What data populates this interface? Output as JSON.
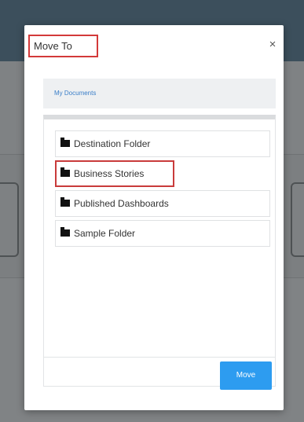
{
  "dialog": {
    "title": "Move To",
    "close_label": "×",
    "breadcrumb": "My Documents",
    "folders": [
      {
        "label": "Destination Folder"
      },
      {
        "label": "Business Stories"
      },
      {
        "label": "Published Dashboards"
      },
      {
        "label": "Sample Folder"
      }
    ],
    "move_label": "Move"
  },
  "colors": {
    "accent": "#2d9cf0",
    "highlight": "#d33a3a",
    "link": "#3a7ec8"
  },
  "icons": {
    "folder": "folder-icon",
    "close": "close-icon"
  }
}
